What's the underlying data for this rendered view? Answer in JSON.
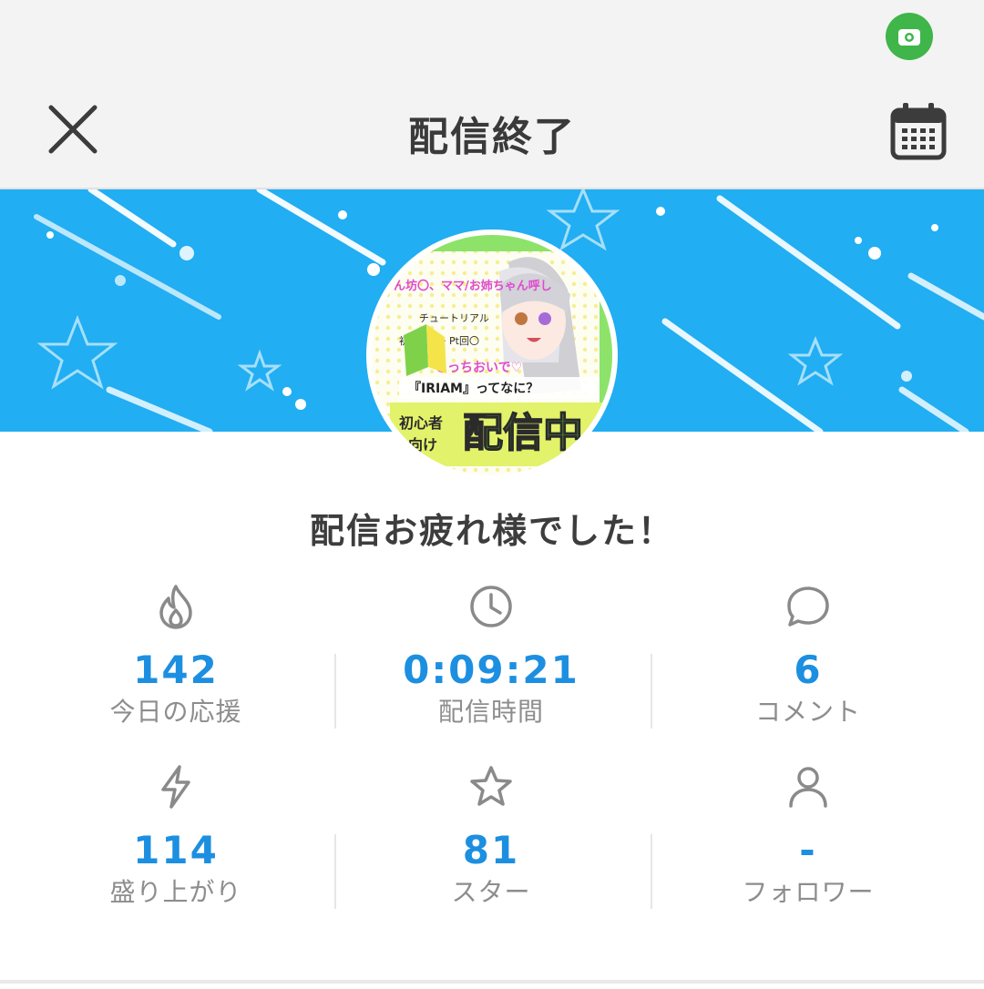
{
  "header": {
    "title": "配信終了",
    "close_icon": "close-icon",
    "calendar_icon": "calendar-icon"
  },
  "status_bar": {
    "indicator_icon": "camera-indicator-icon",
    "indicator_color": "#3fb54a"
  },
  "banner": {
    "color": "#21aef2",
    "avatar": {
      "texts": [
        "ん坊〇、ママ/お姉ちゃん呼し",
        "チュートリアル",
        "初見さん・Pt回〇",
        "こっちおいで♡",
        "『IRIAM』ってなに？",
        "初心者",
        "向け",
        "配信中"
      ]
    }
  },
  "summary": {
    "title": "配信お疲れ様でした！"
  },
  "stats": [
    {
      "icon": "flame-icon",
      "value": "142",
      "label": "今日の応援"
    },
    {
      "icon": "clock-icon",
      "value": "0:09:21",
      "label": "配信時間"
    },
    {
      "icon": "comment-bubble-icon",
      "value": "6",
      "label": "コメント"
    },
    {
      "icon": "lightning-icon",
      "value": "114",
      "label": "盛り上がり"
    },
    {
      "icon": "star-icon",
      "value": "81",
      "label": "スター"
    },
    {
      "icon": "user-icon",
      "value": "-",
      "label": "フォロワー"
    }
  ],
  "colors": {
    "accent": "#1d8fe0",
    "label_gray": "#8d8d8d"
  }
}
